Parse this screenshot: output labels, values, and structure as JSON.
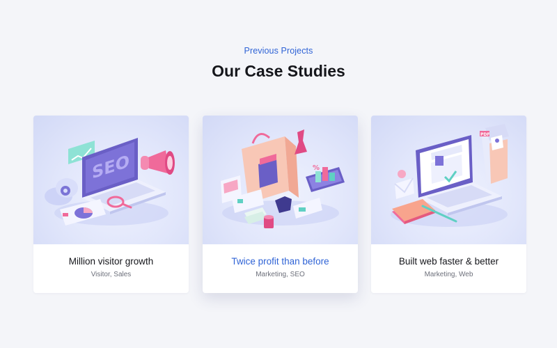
{
  "section": {
    "eyebrow": "Previous Projects",
    "title": "Our Case Studies"
  },
  "cards": [
    {
      "title": "Million visitor growth",
      "tags": "Visitor, Sales",
      "illustration_text": "SEO"
    },
    {
      "title": "Twice profit than before",
      "tags": "Marketing, SEO",
      "illustration_text": "%"
    },
    {
      "title": "Built web faster & better",
      "tags": "Marketing, Web",
      "illustration_text": "PDF"
    }
  ],
  "colors": {
    "accent": "#2f63d6",
    "heading": "#15161b",
    "muted": "#6c6f7a",
    "page_background": "#f4f5f9",
    "illustration_purple": "#7467c8",
    "illustration_pink": "#f06a9a",
    "illustration_peach": "#f7c0ad",
    "illustration_teal": "#5fd0c3"
  }
}
